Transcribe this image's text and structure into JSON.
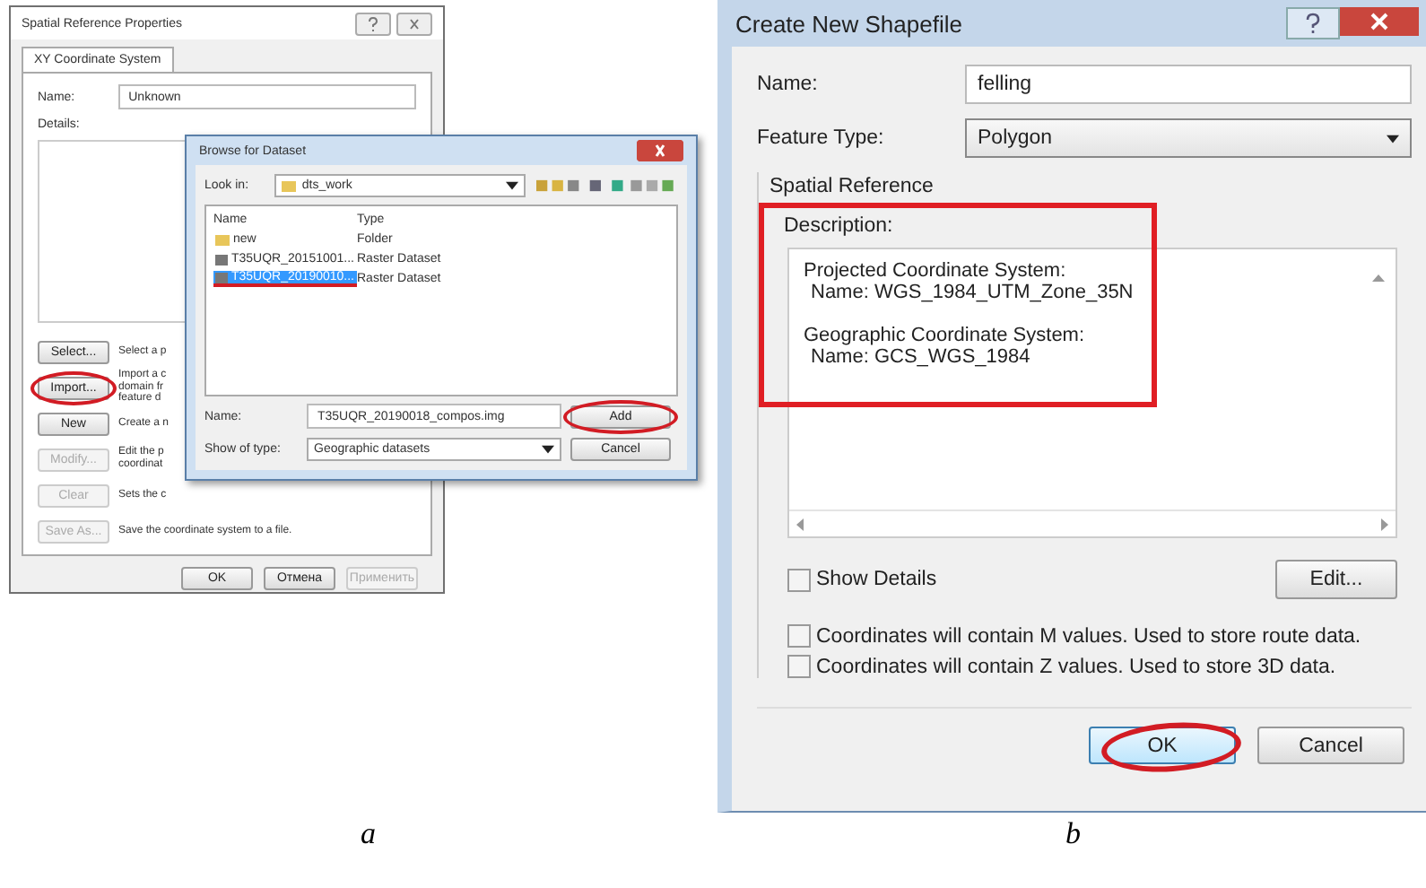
{
  "panel_a": {
    "properties_window": {
      "title": "Spatial Reference Properties",
      "tabs": [
        {
          "label": "XY Coordinate System",
          "selected": true
        }
      ],
      "name_label": "Name:",
      "name_value": "Unknown",
      "details_label": "Details:",
      "actions": [
        {
          "button": "Select...",
          "description": [
            "Select a p"
          ],
          "disabled": false,
          "highlighted": false
        },
        {
          "button": "Import...",
          "description": [
            "Import a c",
            "domain fr",
            "feature d"
          ],
          "disabled": false,
          "highlighted": true
        },
        {
          "button": "New",
          "description": [
            "Create a n"
          ],
          "disabled": false,
          "highlighted": false
        },
        {
          "button": "Modify...",
          "description": [
            "Edit the p",
            "coordinat"
          ],
          "disabled": true,
          "highlighted": false
        },
        {
          "button": "Clear",
          "description": [
            "Sets the c"
          ],
          "disabled": true,
          "highlighted": false
        },
        {
          "button": "Save As...",
          "description": [
            "Save the coordinate system to a file."
          ],
          "disabled": true,
          "highlighted": false
        }
      ],
      "buttons": [
        {
          "label": "OK",
          "disabled": false
        },
        {
          "label": "Отмена",
          "disabled": false
        },
        {
          "label": "Применить",
          "disabled": true
        }
      ]
    },
    "browse_dialog": {
      "title": "Browse for Dataset",
      "look_in_label": "Look in:",
      "look_in_value": "dts_work",
      "columns": [
        "Name",
        "Type"
      ],
      "rows": [
        {
          "kind": "folder",
          "name": "new",
          "type": "Folder",
          "selected": false
        },
        {
          "kind": "raster",
          "name": "T35UQR_20151001...",
          "type": "Raster Dataset",
          "selected": false
        },
        {
          "kind": "raster",
          "name": "T35UQR_20190010...",
          "type": "Raster Dataset",
          "selected": true
        }
      ],
      "name_label": "Name:",
      "name_value": "T35UQR_20190018_compos.img",
      "show_type_label": "Show of type:",
      "show_type_value": "Geographic datasets",
      "buttons": [
        {
          "label": "Add",
          "highlighted": true
        },
        {
          "label": "Cancel",
          "highlighted": false
        }
      ]
    },
    "caption": "a"
  },
  "panel_b": {
    "window": {
      "title": "Create New Shapefile"
    },
    "name_label": "Name:",
    "name_value": "felling",
    "feature_type_label": "Feature Type:",
    "feature_type_value": "Polygon",
    "group_title": "Spatial Reference",
    "description_label": "Description:",
    "description_lines": [
      {
        "kind": "heading",
        "text": "Projected Coordinate System:"
      },
      {
        "kind": "value",
        "text": "Name: WGS_1984_UTM_Zone_35N"
      },
      {
        "kind": "heading",
        "text": "Geographic Coordinate System:"
      },
      {
        "kind": "value",
        "text": "Name: GCS_WGS_1984"
      }
    ],
    "show_details": {
      "label": "Show Details",
      "checked": false
    },
    "edit_button": "Edit...",
    "options": [
      {
        "label": "Coordinates will contain M values. Used to store route data.",
        "checked": false
      },
      {
        "label": "Coordinates will contain Z values. Used to store 3D data.",
        "checked": false
      }
    ],
    "buttons": [
      {
        "label": "OK",
        "highlighted": true
      },
      {
        "label": "Cancel",
        "highlighted": false
      }
    ],
    "caption": "b"
  }
}
